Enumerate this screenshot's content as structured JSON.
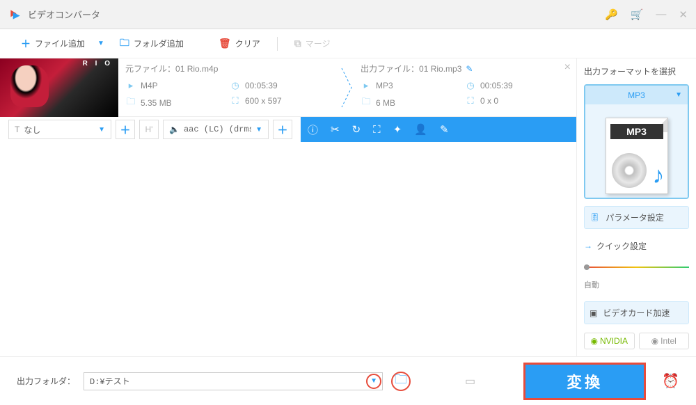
{
  "title": "ビデオコンバータ",
  "toolbar": {
    "add_file": "ファイル追加",
    "add_folder": "フォルダ追加",
    "clear": "クリア",
    "merge": "マージ"
  },
  "file": {
    "source": {
      "label": "元ファイル：",
      "name": "01 Rio.m4p",
      "format": "M4P",
      "duration": "00:05:39",
      "size": "5.35 MB",
      "dimensions": "600 x 597"
    },
    "output": {
      "label": "出力ファイル：",
      "name": "01 Rio.mp3",
      "format": "MP3",
      "duration": "00:05:39",
      "size": "6 MB",
      "dimensions": "0 x 0"
    }
  },
  "controls": {
    "subtitle": "なし",
    "audio": "aac (LC) (drms ."
  },
  "sidebar": {
    "format_label": "出力フォーマットを選択",
    "format": "MP3",
    "format_badge": "MP3",
    "param_settings": "パラメータ設定",
    "quick_settings": "クイック設定",
    "slider_label": "自動",
    "gpu_accel": "ビデオカード加速",
    "nvidia": "NVIDIA",
    "intel": "Intel"
  },
  "footer": {
    "output_folder_label": "出力フォルダ：",
    "output_folder_value": "D:¥テスト",
    "convert": "変換"
  }
}
